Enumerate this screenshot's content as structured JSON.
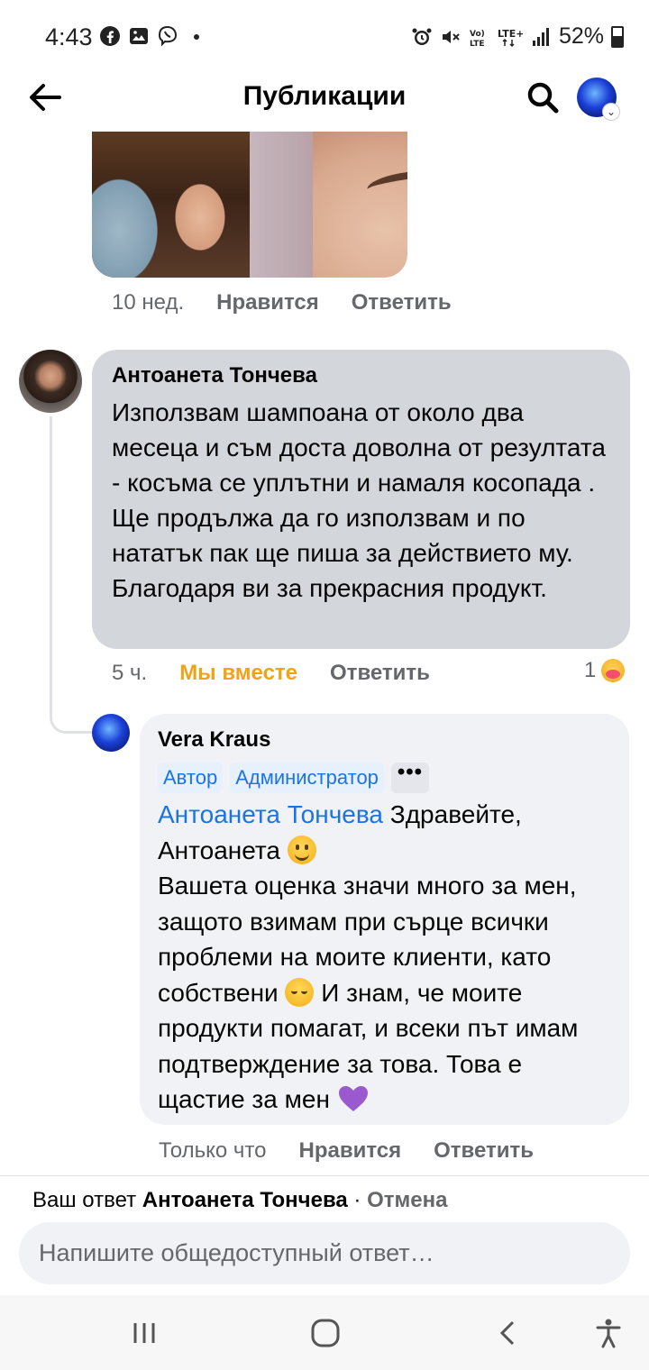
{
  "status_bar": {
    "time": "4:43",
    "left_icons": [
      "facebook-icon",
      "gallery-icon",
      "viber-icon",
      "dot-icon"
    ],
    "right_icons": [
      "alarm-icon",
      "mute-icon",
      "volte-icon",
      "lte-icon",
      "signal-icon"
    ],
    "battery": "52%"
  },
  "header": {
    "title": "Публикации"
  },
  "post_photo": {
    "time": "10 нед.",
    "like_label": "Нравится",
    "reply_label": "Ответить"
  },
  "comment": {
    "author": "Антоанета Тончева",
    "text": "Използвам шампоана от около два месеца и съм доста доволна от резултата - косъма се уплътни и намаля косопада . Ще продължа да го използвам и по нататък пак ще пиша за действието му. Благодаря ви за прекрасния продукт.",
    "time": "5 ч.",
    "reaction_label": "Мы вместе",
    "reply_label": "Ответить",
    "reaction_count": "1",
    "reaction_icon": "care-emoji-icon",
    "reaction_color": "#f0a31a"
  },
  "reply": {
    "author": "Vera Kraus",
    "badges": [
      "Автор",
      "Администратор"
    ],
    "mention": "Антоанета Тончева",
    "text_1": " Здравейте, Антоанета ",
    "text_2": "Вашета оценка значи много за мен, защото взимам при сърце всички проблеми на моите клиенти, като собствени ",
    "text_3": " И знам, че моите продукти помагат, и всеки път имам подтверждение за това. Това е щастие за мен ",
    "time": "Только что",
    "like_label": "Нравится",
    "reply_label": "Ответить"
  },
  "composer": {
    "replying_prefix": "Ваш ответ ",
    "replying_name": "Антоанета Тончева",
    "separator": " · ",
    "cancel_label": "Отмена",
    "placeholder": "Напишите общедоступный ответ…"
  },
  "colors": {
    "link": "#1b74e4",
    "muted": "#65676b",
    "bubble_gray": "#d3d6db",
    "bubble_light": "#f0f2f5"
  }
}
